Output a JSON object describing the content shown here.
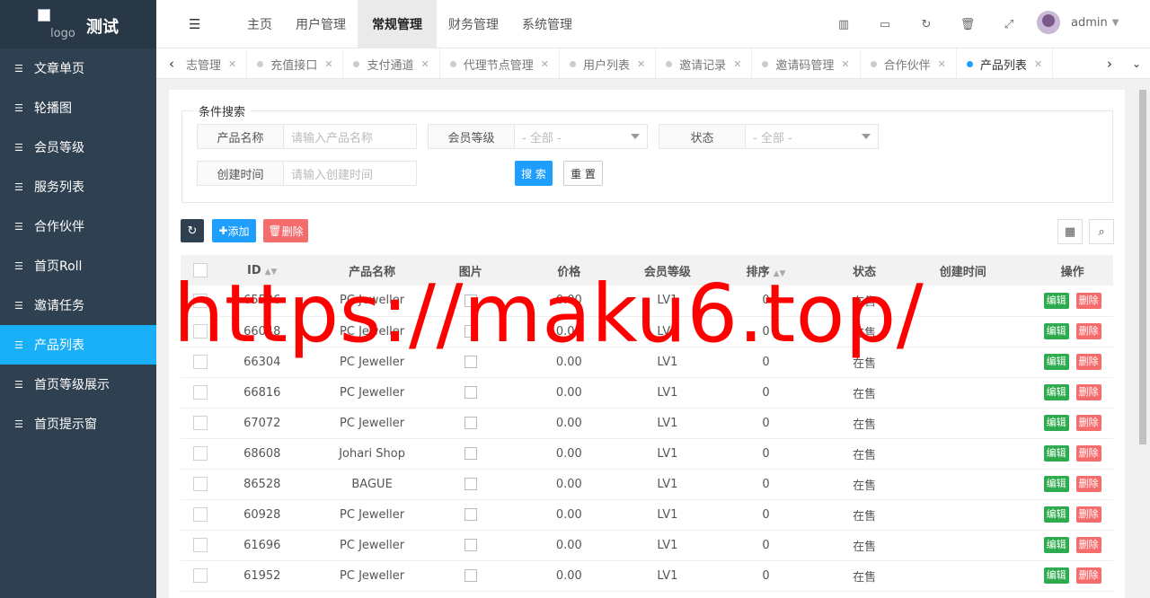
{
  "app": {
    "title": "测试",
    "logo_alt": "logo"
  },
  "sidebar": {
    "items": [
      {
        "label": "文章单页",
        "active": false
      },
      {
        "label": "轮播图",
        "active": false
      },
      {
        "label": "会员等级",
        "active": false
      },
      {
        "label": "服务列表",
        "active": false
      },
      {
        "label": "合作伙伴",
        "active": false
      },
      {
        "label": "首页Roll",
        "active": false
      },
      {
        "label": "邀请任务",
        "active": false
      },
      {
        "label": "产品列表",
        "active": true
      },
      {
        "label": "首页等级展示",
        "active": false
      },
      {
        "label": "首页提示窗",
        "active": false
      }
    ]
  },
  "header": {
    "nav": [
      "主页",
      "用户管理",
      "常规管理",
      "财务管理",
      "系统管理"
    ],
    "active_nav": "常规管理",
    "user": "admin"
  },
  "tabs": [
    {
      "label": "日志管理",
      "active": false
    },
    {
      "label": "充值接口",
      "active": false
    },
    {
      "label": "支付通道",
      "active": false
    },
    {
      "label": "代理节点管理",
      "active": false
    },
    {
      "label": "用户列表",
      "active": false
    },
    {
      "label": "邀请记录",
      "active": false
    },
    {
      "label": "邀请码管理",
      "active": false
    },
    {
      "label": "合作伙伴",
      "active": false
    },
    {
      "label": "产品列表",
      "active": true
    }
  ],
  "search": {
    "legend": "条件搜索",
    "name_label": "产品名称",
    "name_placeholder": "请输入产品名称",
    "level_label": "会员等级",
    "level_value": "- 全部 -",
    "status_label": "状态",
    "status_value": "- 全部 -",
    "time_label": "创建时间",
    "time_placeholder": "请输入创建时间",
    "search_btn": "搜 索",
    "reset_btn": "重 置"
  },
  "toolbar": {
    "add": "添加",
    "delete": "删除"
  },
  "table": {
    "headers": [
      "ID",
      "产品名称",
      "图片",
      "价格",
      "会员等级",
      "排序",
      "状态",
      "创建时间",
      "操作"
    ],
    "edit_label": "编辑",
    "delete_label": "删除",
    "rows": [
      {
        "id": "65536",
        "name": "PC Jeweller",
        "price": "0.00",
        "level": "LV1",
        "sort": "0",
        "status": "在售",
        "created": ""
      },
      {
        "id": "66048",
        "name": "PC Jeweller",
        "price": "0.00",
        "level": "LV1",
        "sort": "0",
        "status": "在售",
        "created": ""
      },
      {
        "id": "66304",
        "name": "PC Jeweller",
        "price": "0.00",
        "level": "LV1",
        "sort": "0",
        "status": "在售",
        "created": ""
      },
      {
        "id": "66816",
        "name": "PC Jeweller",
        "price": "0.00",
        "level": "LV1",
        "sort": "0",
        "status": "在售",
        "created": ""
      },
      {
        "id": "67072",
        "name": "PC Jeweller",
        "price": "0.00",
        "level": "LV1",
        "sort": "0",
        "status": "在售",
        "created": ""
      },
      {
        "id": "68608",
        "name": "Johari Shop",
        "price": "0.00",
        "level": "LV1",
        "sort": "0",
        "status": "在售",
        "created": ""
      },
      {
        "id": "86528",
        "name": "BAGUE",
        "price": "0.00",
        "level": "LV1",
        "sort": "0",
        "status": "在售",
        "created": ""
      },
      {
        "id": "60928",
        "name": "PC Jeweller",
        "price": "0.00",
        "level": "LV1",
        "sort": "0",
        "status": "在售",
        "created": ""
      },
      {
        "id": "61696",
        "name": "PC Jeweller",
        "price": "0.00",
        "level": "LV1",
        "sort": "0",
        "status": "在售",
        "created": ""
      },
      {
        "id": "61952",
        "name": "PC Jeweller",
        "price": "0.00",
        "level": "LV1",
        "sort": "0",
        "status": "在售",
        "created": ""
      }
    ]
  },
  "watermark": "https://maku6.top/",
  "colors": {
    "sidebar_bg": "#2f4050",
    "active_blue": "#1ab0f8",
    "edit_green": "#2eaa4f",
    "delete_red": "#f56c6c",
    "watermark_red": "#ff0000"
  }
}
